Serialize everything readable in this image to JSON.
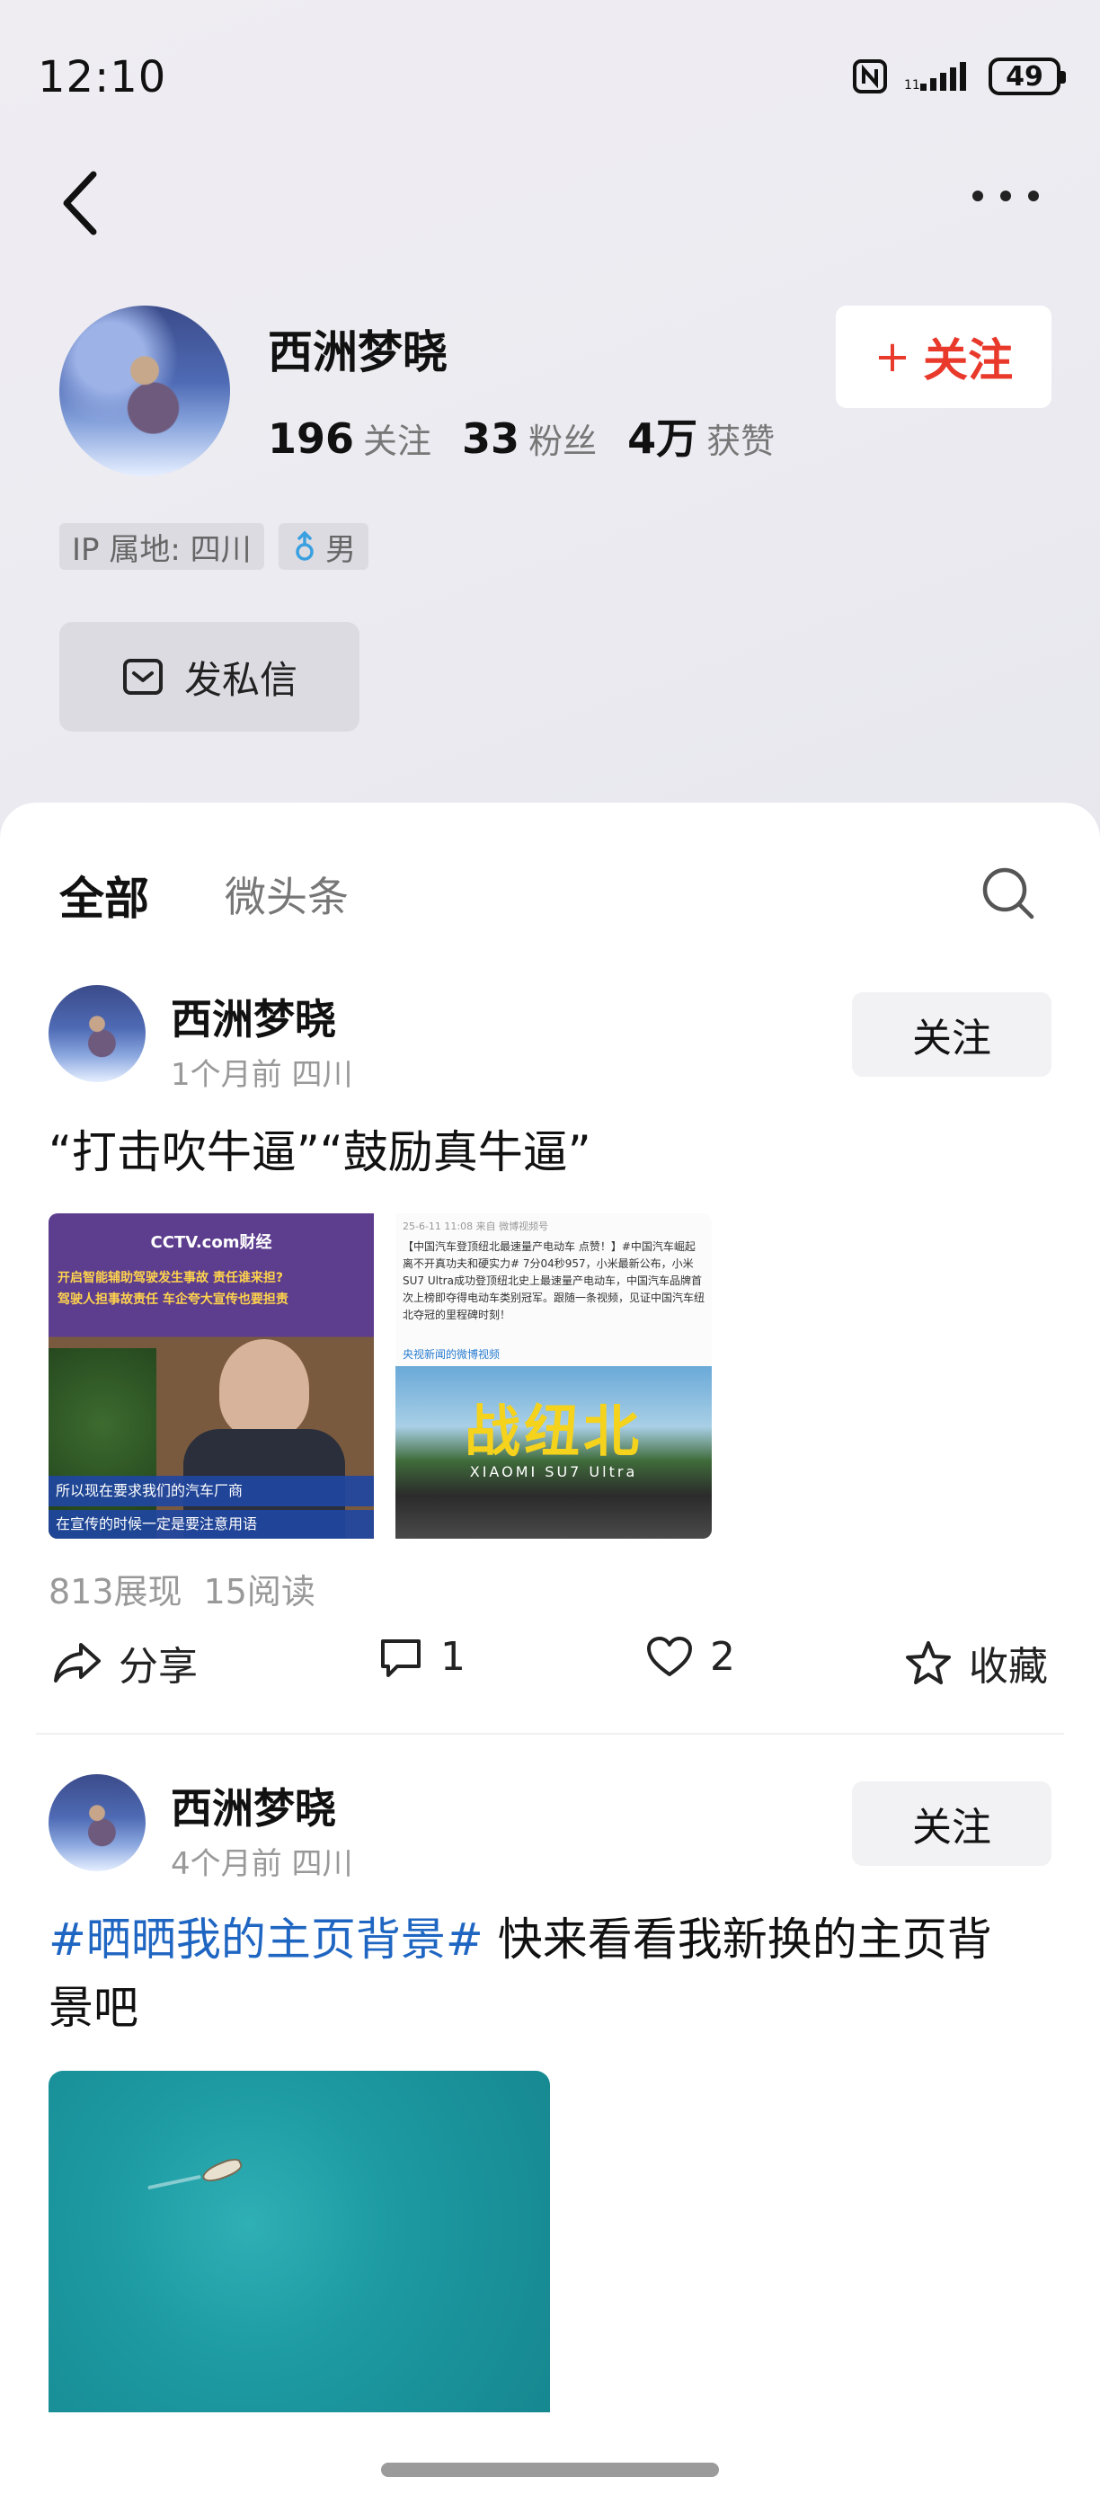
{
  "status_bar": {
    "time": "12:10",
    "battery": "49",
    "icons": [
      "nfc-icon",
      "signal-icon",
      "battery-icon"
    ]
  },
  "nav": {
    "back_icon": "chevron-left-icon",
    "more_icon": "more-dots-icon"
  },
  "profile": {
    "name": "西洲梦晓",
    "stats": [
      {
        "value": "196",
        "label": "关注"
      },
      {
        "value": "33",
        "label": "粉丝"
      },
      {
        "value": "4万",
        "label": "获赞"
      }
    ],
    "follow_label": "关注",
    "ip_tag": "IP 属地: 四川",
    "gender_tag": "男",
    "dm_label": "发私信"
  },
  "tabs": {
    "all": "全部",
    "micro": "微头条"
  },
  "posts": [
    {
      "name": "西洲梦晓",
      "meta": "1个月前 四川",
      "follow_label": "关注",
      "text": "“打击吹牛逼”“鼓励真牛逼”",
      "images": {
        "left": {
          "brand": "CCTV.com财经",
          "headline": "开启智能辅助驾驶发生事故 责任谁来担?",
          "subline": "驾驶人担事故责任 车企夸大宣传也要担责",
          "caption1": "所以现在要求我们的汽车厂商",
          "caption2": "在宣传的时候一定是要注意用语"
        },
        "right": {
          "header": "25-6-11 11:08  来自 微博视频号",
          "body": "【中国汽车登顶纽北最速量产电动车 点赞！】#中国汽车崛起离不开真功夫和硬实力# 7分04秒957，小米最新公布，小米SU7 Ultra成功登顶纽北史上最速量产电动车，中国汽车品牌首次上榜即夺得电动车类别冠军。跟随一条视频，见证中国汽车纽北夺冠的里程碑时刻！",
          "source": "央视新闻的微博视频",
          "title": "战纽北",
          "model": "XIAOMI SU7 Ultra"
        }
      },
      "impressions": "813展现",
      "reads": "15阅读",
      "actions": {
        "share": "分享",
        "comments": "1",
        "likes": "2",
        "favorite": "收藏"
      }
    },
    {
      "name": "西洲梦晓",
      "meta": "4个月前 四川",
      "follow_label": "关注",
      "hashtag": "#晒晒我的主页背景#",
      "text_line1": " 快来看看我新换的主页背",
      "text_line2": "景吧"
    }
  ],
  "colors": {
    "accent": "#e8392b",
    "hashtag": "#1f66c2",
    "muted": "#999999"
  }
}
